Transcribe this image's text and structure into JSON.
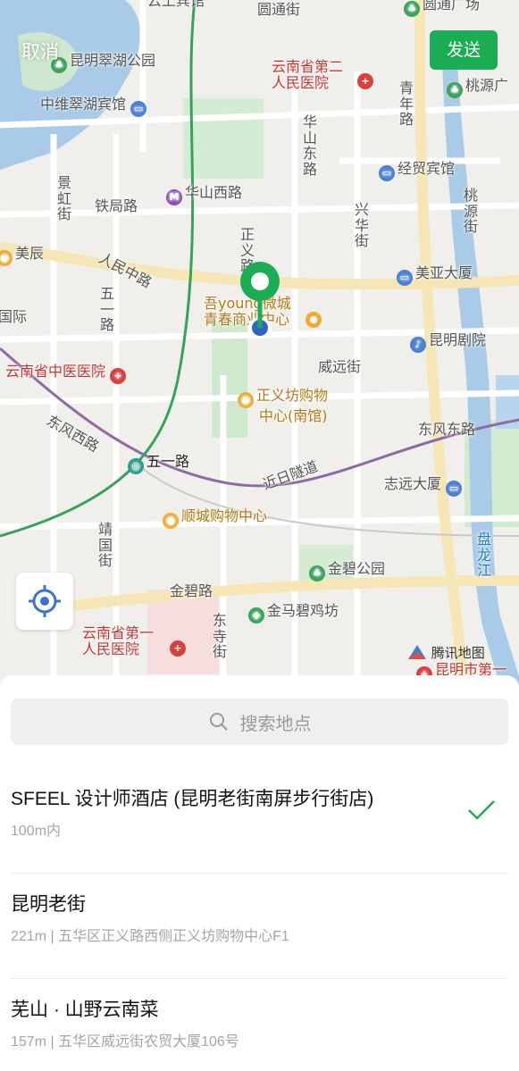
{
  "header": {
    "cancel_label": "取消",
    "send_label": "发送",
    "accent_color": "#1aad53"
  },
  "map": {
    "labels": {
      "yunshang": "云上宾馆",
      "yuantong_st": "圆通街",
      "yuantong_plaza": "圆通广场",
      "cuihu_park": "昆明翠湖公园",
      "hospital2_a": "云南省第二",
      "hospital2_b": "人民医院",
      "qingnian_rd": "青年路",
      "taoyuan_plaza": "桃源广",
      "zhongwei_hotel": "中维翠湖宾馆",
      "huashan_east": "华山东路",
      "jingmao_hotel": "经贸宾馆",
      "jinghong_st": "景虹街",
      "tieju_rd": "铁局路",
      "huashan_west": "华山西路",
      "taoyuan_st": "桃源街",
      "xinghua_st": "兴华街",
      "zhengyi_rd": "正义路",
      "meichen": "美辰",
      "renmin_mid": "人民中路",
      "meiya_tower": "美亚大厦",
      "wuyi_rd_v": "五一路",
      "guoji": "国际",
      "wuyoung_a": "吾young微城",
      "wuyoung_b": "青春商业中心",
      "kunming_theater": "昆明剧院",
      "tcm_hospital": "云南省中医医院",
      "weiyuan_st": "威远街",
      "zhengyifang_a": "正义坊购物",
      "zhengyifang_b": "中心(南馆)",
      "dongfeng_west": "东风西路",
      "dongfeng_east": "东风东路",
      "wuyi_rd": "五一路",
      "jinri_tunnel": "近日隧道",
      "zhiyuan_tower": "志远大厦",
      "shuncheng": "顺城购物中心",
      "jingguo_st": "靖国街",
      "panlong_river": "盘龙江",
      "jinbi_park": "金碧公园",
      "jinbi_rd": "金碧路",
      "jinma_biji": "金马碧鸡坊",
      "dongsi_st": "东寺街",
      "hospital1_a": "云南省第一",
      "hospital1_b": "人民医院",
      "kunming_no1": "昆明市第一"
    },
    "watermark": "腾讯地图",
    "locate_icon": "locate-crosshair-icon"
  },
  "search": {
    "placeholder": "搜索地点"
  },
  "places": [
    {
      "name": "SFEEL 设计师酒店 (昆明老街南屏步行街店)",
      "sub": "100m内",
      "selected": true
    },
    {
      "name": "昆明老街",
      "sub": "221m | 五华区正义路西侧正义坊购物中心F1",
      "selected": false
    },
    {
      "name": "芜山 · 山野云南菜",
      "sub": "157m | 五华区威远街农贸大厦106号",
      "selected": false
    }
  ]
}
